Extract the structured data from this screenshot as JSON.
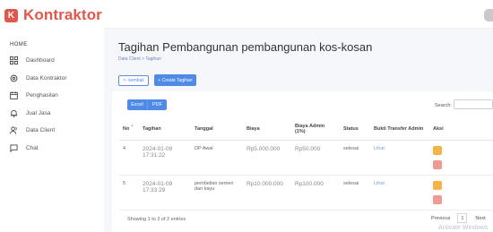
{
  "brand": {
    "name": "Kontraktor",
    "logo_letter": "K"
  },
  "sidebar": {
    "heading": "HOME",
    "items": [
      {
        "label": "Dashboard",
        "icon": "grid-icon"
      },
      {
        "label": "Data Kontraktor",
        "icon": "settings-icon"
      },
      {
        "label": "Penghasilan",
        "icon": "calendar-icon"
      },
      {
        "label": "Jual Jasa",
        "icon": "bell-icon"
      },
      {
        "label": "Data Client",
        "icon": "users-icon"
      },
      {
        "label": "Chat",
        "icon": "chat-icon"
      }
    ]
  },
  "page": {
    "title": "Tagihan Pembangunan pembangunan kos-kosan",
    "breadcrumb": "Data Client > Tagihan"
  },
  "actions": {
    "back_label": "<- kembali",
    "create_label": "+ Create Tagihan"
  },
  "table_tools": {
    "excel_label": "Excel",
    "pdf_label": "PDF",
    "search_label": "Search:",
    "search_value": ""
  },
  "table": {
    "headers": [
      "No",
      "Tagihan",
      "Tanggal",
      "Biaya",
      "Biaya Admin (1%)",
      "Status",
      "Bukti Transfer Admin",
      "Aksi"
    ],
    "rows": [
      {
        "no": "4",
        "tagihan": "2024-01-09 17:31:22",
        "tanggal": "DP Awal",
        "biaya": "Rp5.000.000",
        "admin": "Rp50.000",
        "status": "selesai",
        "bukti": "Lihat"
      },
      {
        "no": "5",
        "tagihan": "2024-01-09 17:33:29",
        "tanggal": "pembelian semen dan kayu",
        "biaya": "Rp10.000.000",
        "admin": "Rp100.000",
        "status": "selesai",
        "bukti": "Lihat"
      }
    ]
  },
  "footer": {
    "showing": "Showing 1 to 2 of 2 entries",
    "previous": "Previous",
    "page": "1",
    "next": "Next",
    "watermark": "Activate Windows"
  },
  "colors": {
    "brand": "#e2574c",
    "primary": "#4e8ae6",
    "edit": "#f7b24a",
    "delete": "#f19a93"
  }
}
